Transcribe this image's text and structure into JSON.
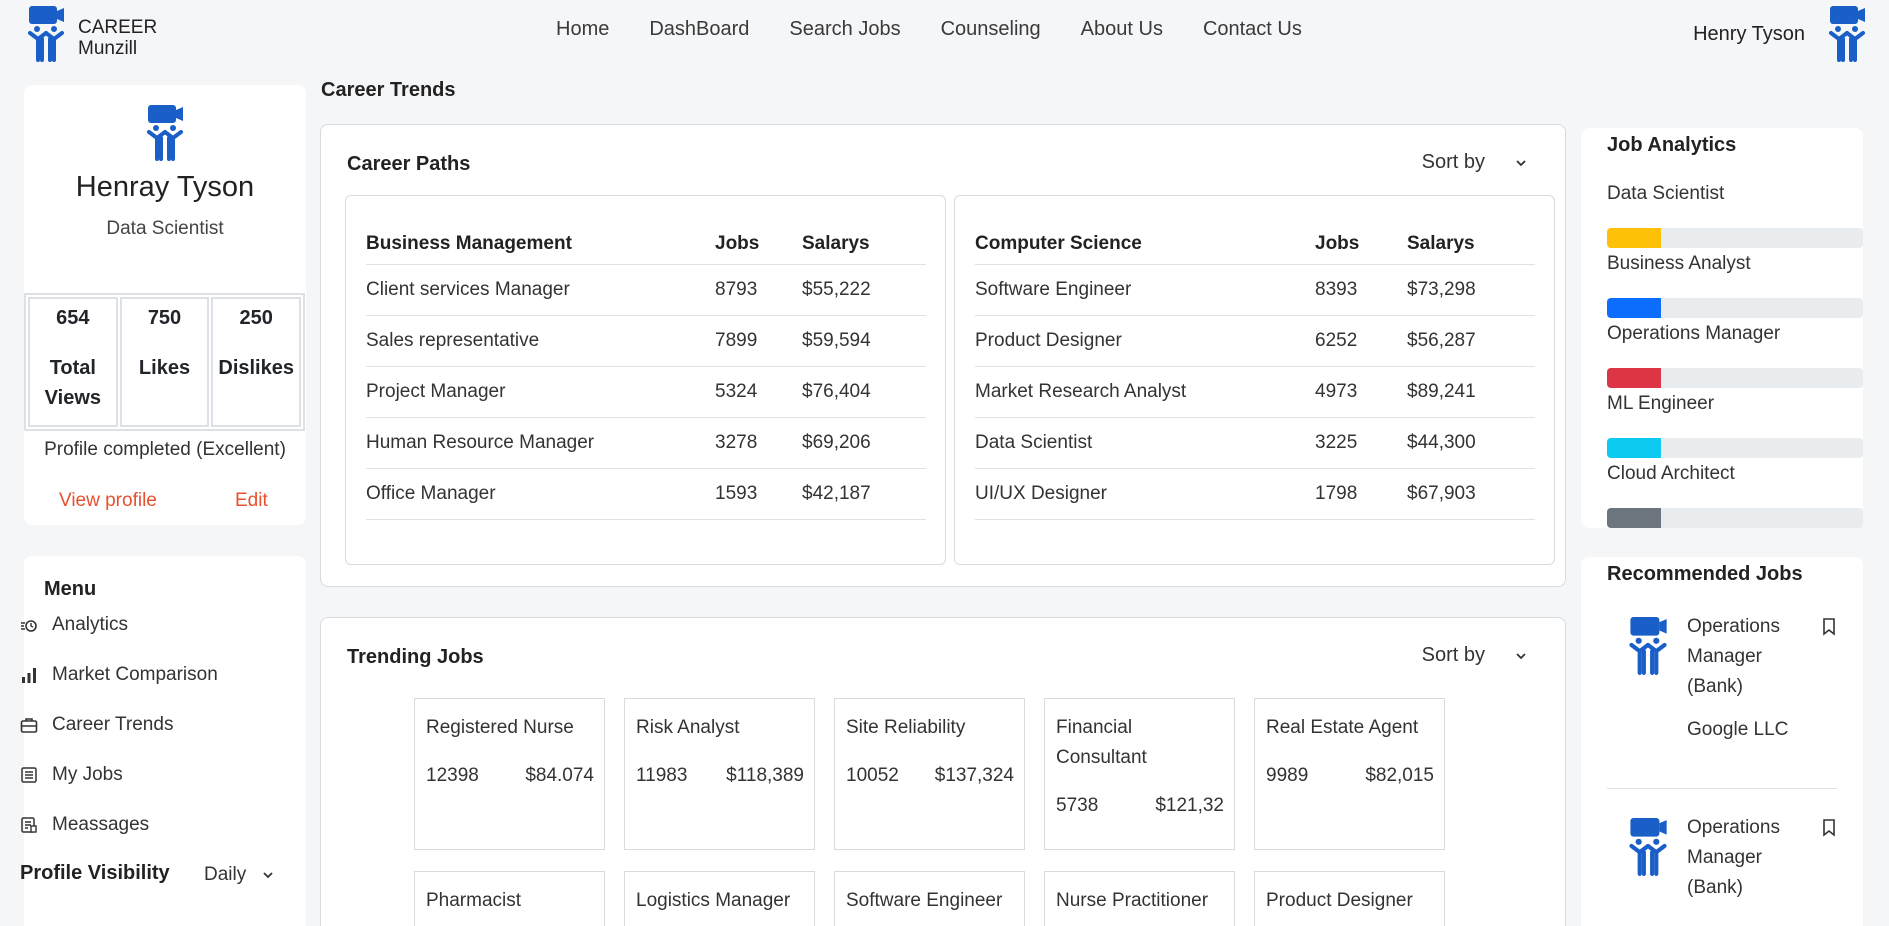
{
  "brand": {
    "line1": "CAREER",
    "line2": "Munzill"
  },
  "nav": [
    "Home",
    "DashBoard",
    "Search Jobs",
    "Counseling",
    "About Us",
    "Contact Us"
  ],
  "user": {
    "name": "Henry Tyson"
  },
  "profile": {
    "name": "Henray Tyson",
    "role": "Data Scientist",
    "stats": [
      {
        "value": "654",
        "label": "Total Views"
      },
      {
        "value": "750",
        "label": "Likes"
      },
      {
        "value": "250",
        "label": "Dislikes"
      }
    ],
    "status": "Profile completed (Excellent)",
    "view_label": "View profile",
    "edit_label": "Edit"
  },
  "menu": {
    "title": "Menu",
    "items": [
      {
        "label": "Analytics",
        "icon": "analytics-icon"
      },
      {
        "label": "Market Comparison",
        "icon": "bar-chart-icon"
      },
      {
        "label": "Career Trends",
        "icon": "briefcase-icon"
      },
      {
        "label": "My Jobs",
        "icon": "list-icon"
      },
      {
        "label": "Meassages",
        "icon": "message-icon"
      }
    ],
    "visibility_label": "Profile Visibility",
    "visibility_value": "Daily"
  },
  "page_title": "Career Trends",
  "career_paths": {
    "title": "Career Paths",
    "sort_label": "Sort by",
    "tables": [
      {
        "headers": [
          "Business Management",
          "Jobs",
          "Salarys"
        ],
        "rows": [
          [
            "Client services Manager",
            "8793",
            "$55,222"
          ],
          [
            "Sales representative",
            "7899",
            "$59,594"
          ],
          [
            "Project Manager",
            "5324",
            "$76,404"
          ],
          [
            "Human Resource Manager",
            "3278",
            "$69,206"
          ],
          [
            "Office Manager",
            "1593",
            "$42,187"
          ]
        ]
      },
      {
        "headers": [
          "Computer Science",
          "Jobs",
          "Salarys"
        ],
        "rows": [
          [
            "Software Engineer",
            "8393",
            "$73,298"
          ],
          [
            "Product Designer",
            "6252",
            "$56,287"
          ],
          [
            "Market Research Analyst",
            "4973",
            "$89,241"
          ],
          [
            "Data Scientist",
            "3225",
            "$44,300"
          ],
          [
            "UI/UX Designer",
            "1798",
            "$67,903"
          ]
        ]
      }
    ]
  },
  "trending": {
    "title": "Trending Jobs",
    "sort_label": "Sort by",
    "jobs": [
      {
        "title": "Registered Nurse",
        "count": "12398",
        "salary": "$84.074"
      },
      {
        "title": "Risk Analyst",
        "count": "11983",
        "salary": "$118,389"
      },
      {
        "title": "Site Reliability",
        "count": "10052",
        "salary": "$137,324"
      },
      {
        "title": "Financial Consultant",
        "count": "5738",
        "salary": "$121,32"
      },
      {
        "title": "Real Estate Agent",
        "count": "9989",
        "salary": "$82,015"
      },
      {
        "title": "Pharmacist"
      },
      {
        "title": "Logistics Manager"
      },
      {
        "title": "Software Engineer"
      },
      {
        "title": "Nurse Practitioner"
      },
      {
        "title": "Product Designer"
      }
    ]
  },
  "analytics": {
    "title": "Job Analytics",
    "items": [
      {
        "label": "Data Scientist",
        "color": "#ffc107",
        "fill": 0.21
      },
      {
        "label": "Business Analyst",
        "color": "#0d6efd",
        "fill": 0.21
      },
      {
        "label": "Operations Manager",
        "color": "#dc3545",
        "fill": 0.21
      },
      {
        "label": "ML Engineer",
        "color": "#0dcaf0",
        "fill": 0.21
      },
      {
        "label": "Cloud Architect",
        "color": "#6c757d",
        "fill": 0.21
      }
    ]
  },
  "recommended": {
    "title": "Recommended Jobs",
    "items": [
      {
        "title": "Operations Manager (Bank)",
        "company": "Google LLC"
      },
      {
        "title": "Operations Manager (Bank)"
      }
    ]
  },
  "colors": {
    "brand": "#1a5fc8",
    "link": "#e8502f"
  }
}
